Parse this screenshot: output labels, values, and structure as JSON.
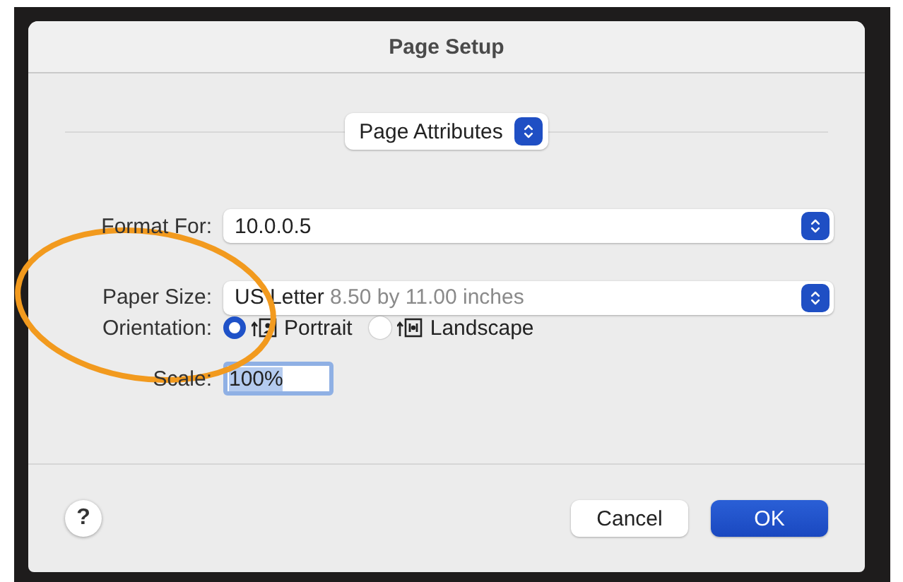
{
  "window": {
    "title": "Page Setup"
  },
  "section_popup": {
    "value": "Page Attributes"
  },
  "fields": [
    {
      "kind": "popup",
      "label": "Format For:",
      "value": "10.0.0.5"
    },
    {
      "kind": "popup",
      "label": "Paper Size:",
      "value": "US Letter",
      "detail": "8.50 by 11.00 inches"
    },
    {
      "kind": "radios",
      "label": "Orientation:",
      "options": [
        {
          "label": "Portrait",
          "selected": true
        },
        {
          "label": "Landscape",
          "selected": false
        }
      ]
    },
    {
      "kind": "text",
      "label": "Scale:",
      "value": "100%",
      "text_selected": true
    }
  ],
  "help_button": {
    "label": "?"
  },
  "buttons": [
    {
      "label": "Cancel",
      "default": false
    },
    {
      "label": "OK",
      "default": true
    }
  ]
}
